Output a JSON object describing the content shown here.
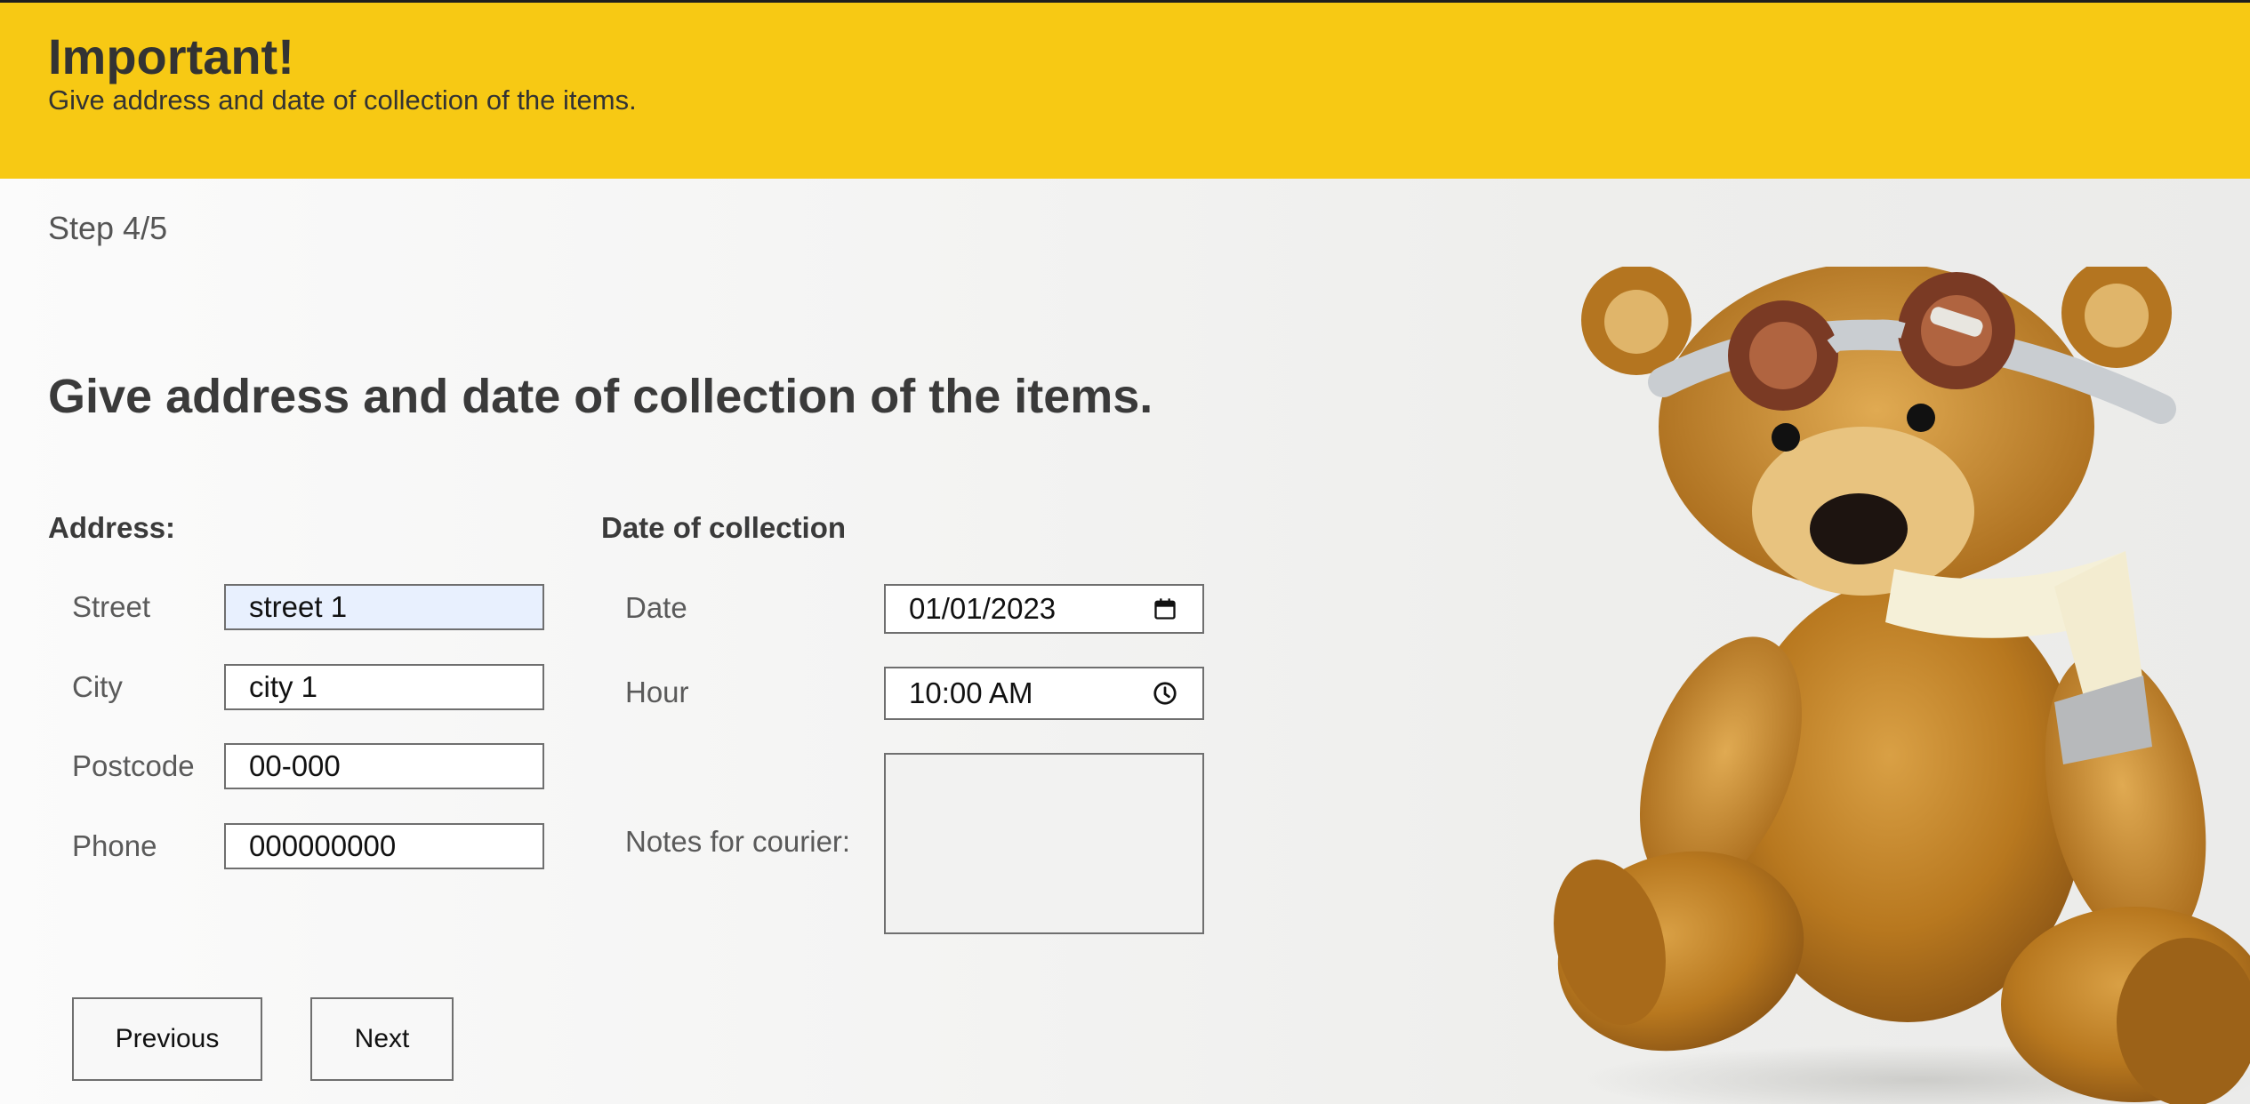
{
  "banner": {
    "title": "Important!",
    "subtitle": "Give address and date of collection of the items."
  },
  "step": "Step 4/5",
  "heading": "Give address and date of collection of the items.",
  "address": {
    "title": "Address:",
    "street": {
      "label": "Street",
      "value": "street 1"
    },
    "city": {
      "label": "City",
      "value": "city 1"
    },
    "postcode": {
      "label": "Postcode",
      "value": "00-000"
    },
    "phone": {
      "label": "Phone",
      "value": "000000000"
    }
  },
  "collection": {
    "title": "Date of collection",
    "date": {
      "label": "Date",
      "value": "01/01/2023",
      "icon": "calendar-icon"
    },
    "hour": {
      "label": "Hour",
      "value": "10:00 AM",
      "icon": "clock-icon"
    },
    "notes": {
      "label": "Notes for courier:",
      "value": ""
    }
  },
  "buttons": {
    "previous": "Previous",
    "next": "Next"
  },
  "colors": {
    "banner": "#f7c914",
    "focused_input": "#e8f0fe"
  },
  "image": "teddy-bear-with-goggles-and-scarf"
}
